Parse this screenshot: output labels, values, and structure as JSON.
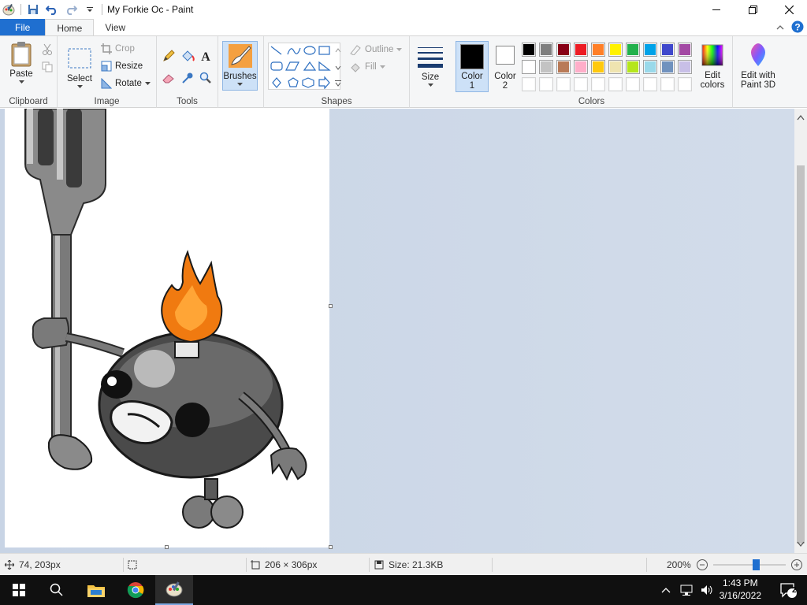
{
  "window": {
    "title": "My Forkie Oc - Paint"
  },
  "tabs": {
    "file": "File",
    "home": "Home",
    "view": "View"
  },
  "clipboard": {
    "paste": "Paste",
    "label": "Clipboard"
  },
  "image": {
    "select": "Select",
    "crop": "Crop",
    "resize": "Resize",
    "rotate": "Rotate",
    "label": "Image"
  },
  "tools": {
    "label": "Tools"
  },
  "brushes": {
    "label": "Brushes"
  },
  "shapes": {
    "outline": "Outline",
    "fill": "Fill",
    "label": "Shapes"
  },
  "size": {
    "label": "Size"
  },
  "colors": {
    "color1_label": "Color",
    "color1_num": "1",
    "color2_label": "Color",
    "color2_num": "2",
    "color1_value": "#000000",
    "color2_value": "#ffffff",
    "edit_colors_line1": "Edit",
    "edit_colors_line2": "colors",
    "edit_3d_line1": "Edit with",
    "edit_3d_line2": "Paint 3D",
    "label": "Colors",
    "palette_row1": [
      "#000000",
      "#7f7f7f",
      "#880015",
      "#ed1c24",
      "#ff7f27",
      "#fff200",
      "#22b14c",
      "#00a2e8",
      "#3f48cc",
      "#a349a4"
    ],
    "palette_row2": [
      "#ffffff",
      "#c3c3c3",
      "#b97a57",
      "#ffaec9",
      "#ffc90e",
      "#efe4b0",
      "#b5e61d",
      "#99d9ea",
      "#7092be",
      "#c8bfe7"
    ],
    "palette_row3": [
      "#ffffff",
      "#ffffff",
      "#ffffff",
      "#ffffff",
      "#ffffff",
      "#ffffff",
      "#ffffff",
      "#ffffff",
      "#ffffff",
      "#ffffff"
    ]
  },
  "status": {
    "cursor_pos": "74, 203px",
    "canvas_size": "206 × 306px",
    "file_size": "Size: 21.3KB",
    "zoom": "200%",
    "zoom_level": 0.6
  },
  "taskbar": {
    "time": "1:43 PM",
    "date": "3/16/2022",
    "notifications": "2"
  }
}
